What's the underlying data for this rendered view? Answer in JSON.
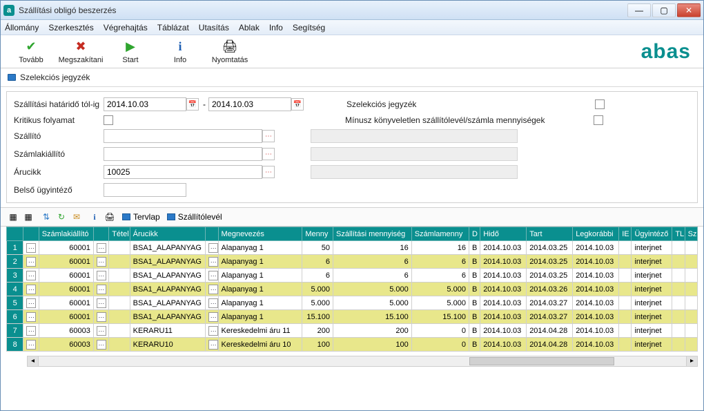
{
  "window": {
    "title": "Szállítási obligó beszerzés"
  },
  "menu": {
    "allomany": "Állomány",
    "szerkesztes": "Szerkesztés",
    "vegrehajtas": "Végrehajtás",
    "tablazat": "Táblázat",
    "utasitas": "Utasítás",
    "ablak": "Ablak",
    "info": "Info",
    "segitseg": "Segítség"
  },
  "toolbar": {
    "tovabb": "Tovább",
    "megszakitani": "Megszakítani",
    "start": "Start",
    "info": "Info",
    "nyomtatas": "Nyomtatás",
    "logo": "abas"
  },
  "section": {
    "szelekcios": "Szelekciós jegyzék"
  },
  "filter": {
    "hatarido_lbl": "Szállítási határidő tól-ig",
    "date_from": "2014.10.03",
    "date_to": "2014.10.03",
    "szelekcios_lbl": "Szelekciós jegyzék",
    "kritikus_lbl": "Kritikus folyamat",
    "minusz_lbl": "Mínusz könyveletlen szállítólevél/számla mennyiségek",
    "szallito_lbl": "Szállító",
    "szamlakiallito_lbl": "Számlakiállító",
    "arucikk_lbl": "Árucikk",
    "arucikk_val": "10025",
    "belso_lbl": "Belső ügyintéző"
  },
  "minibar": {
    "tervlap": "Tervlap",
    "szallitolevel": "Szállítólevél"
  },
  "columns": {
    "c0": "",
    "c1": "",
    "szamlakiallito": "Számlakiállító",
    "c3": "",
    "tetel": "Tétel",
    "arucikk": "Árucikk",
    "c6": "",
    "megnevezes": "Megnevezés",
    "menny": "Menny",
    "szallmenny": "Szállítási mennyiség",
    "szamlamenny": "Számlamenny",
    "d": "D",
    "hido": "Hidő",
    "tart": "Tart",
    "legkorabbi": "Legkorábbi",
    "ie": "IE",
    "ugyintezo": "Ügyintéző",
    "tl": "TL",
    "sz": "Sz"
  },
  "rows": [
    {
      "n": "1",
      "yel": false,
      "szk": "60001",
      "aru": "BSA1_ALAPANYAG",
      "meg": "Alapanyag 1",
      "m": "50",
      "sm": "16",
      "szm": "16",
      "d": "B",
      "hido": "2014.10.03",
      "tart": "2014.03.25",
      "leg": "2014.10.03",
      "ugy": "interjnet"
    },
    {
      "n": "2",
      "yel": true,
      "szk": "60001",
      "aru": "BSA1_ALAPANYAG",
      "meg": "Alapanyag 1",
      "m": "6",
      "sm": "6",
      "szm": "6",
      "d": "B",
      "hido": "2014.10.03",
      "tart": "2014.03.25",
      "leg": "2014.10.03",
      "ugy": "interjnet"
    },
    {
      "n": "3",
      "yel": false,
      "szk": "60001",
      "aru": "BSA1_ALAPANYAG",
      "meg": "Alapanyag 1",
      "m": "6",
      "sm": "6",
      "szm": "6",
      "d": "B",
      "hido": "2014.10.03",
      "tart": "2014.03.25",
      "leg": "2014.10.03",
      "ugy": "interjnet"
    },
    {
      "n": "4",
      "yel": true,
      "szk": "60001",
      "aru": "BSA1_ALAPANYAG",
      "meg": "Alapanyag 1",
      "m": "5.000",
      "sm": "5.000",
      "szm": "5.000",
      "d": "B",
      "hido": "2014.10.03",
      "tart": "2014.03.26",
      "leg": "2014.10.03",
      "ugy": "interjnet"
    },
    {
      "n": "5",
      "yel": false,
      "szk": "60001",
      "aru": "BSA1_ALAPANYAG",
      "meg": "Alapanyag 1",
      "m": "5.000",
      "sm": "5.000",
      "szm": "5.000",
      "d": "B",
      "hido": "2014.10.03",
      "tart": "2014.03.27",
      "leg": "2014.10.03",
      "ugy": "interjnet"
    },
    {
      "n": "6",
      "yel": true,
      "szk": "60001",
      "aru": "BSA1_ALAPANYAG",
      "meg": "Alapanyag 1",
      "m": "15.100",
      "sm": "15.100",
      "szm": "15.100",
      "d": "B",
      "hido": "2014.10.03",
      "tart": "2014.03.27",
      "leg": "2014.10.03",
      "ugy": "interjnet"
    },
    {
      "n": "7",
      "yel": false,
      "szk": "60003",
      "aru": "KERARU11",
      "meg": "Kereskedelmi áru 11",
      "m": "200",
      "sm": "200",
      "szm": "0",
      "d": "B",
      "hido": "2014.10.03",
      "tart": "2014.04.28",
      "leg": "2014.10.03",
      "ugy": "interjnet"
    },
    {
      "n": "8",
      "yel": true,
      "szk": "60003",
      "aru": "KERARU10",
      "meg": "Kereskedelmi áru 10",
      "m": "100",
      "sm": "100",
      "szm": "0",
      "d": "B",
      "hido": "2014.10.03",
      "tart": "2014.04.28",
      "leg": "2014.10.03",
      "ugy": "interjnet"
    }
  ]
}
